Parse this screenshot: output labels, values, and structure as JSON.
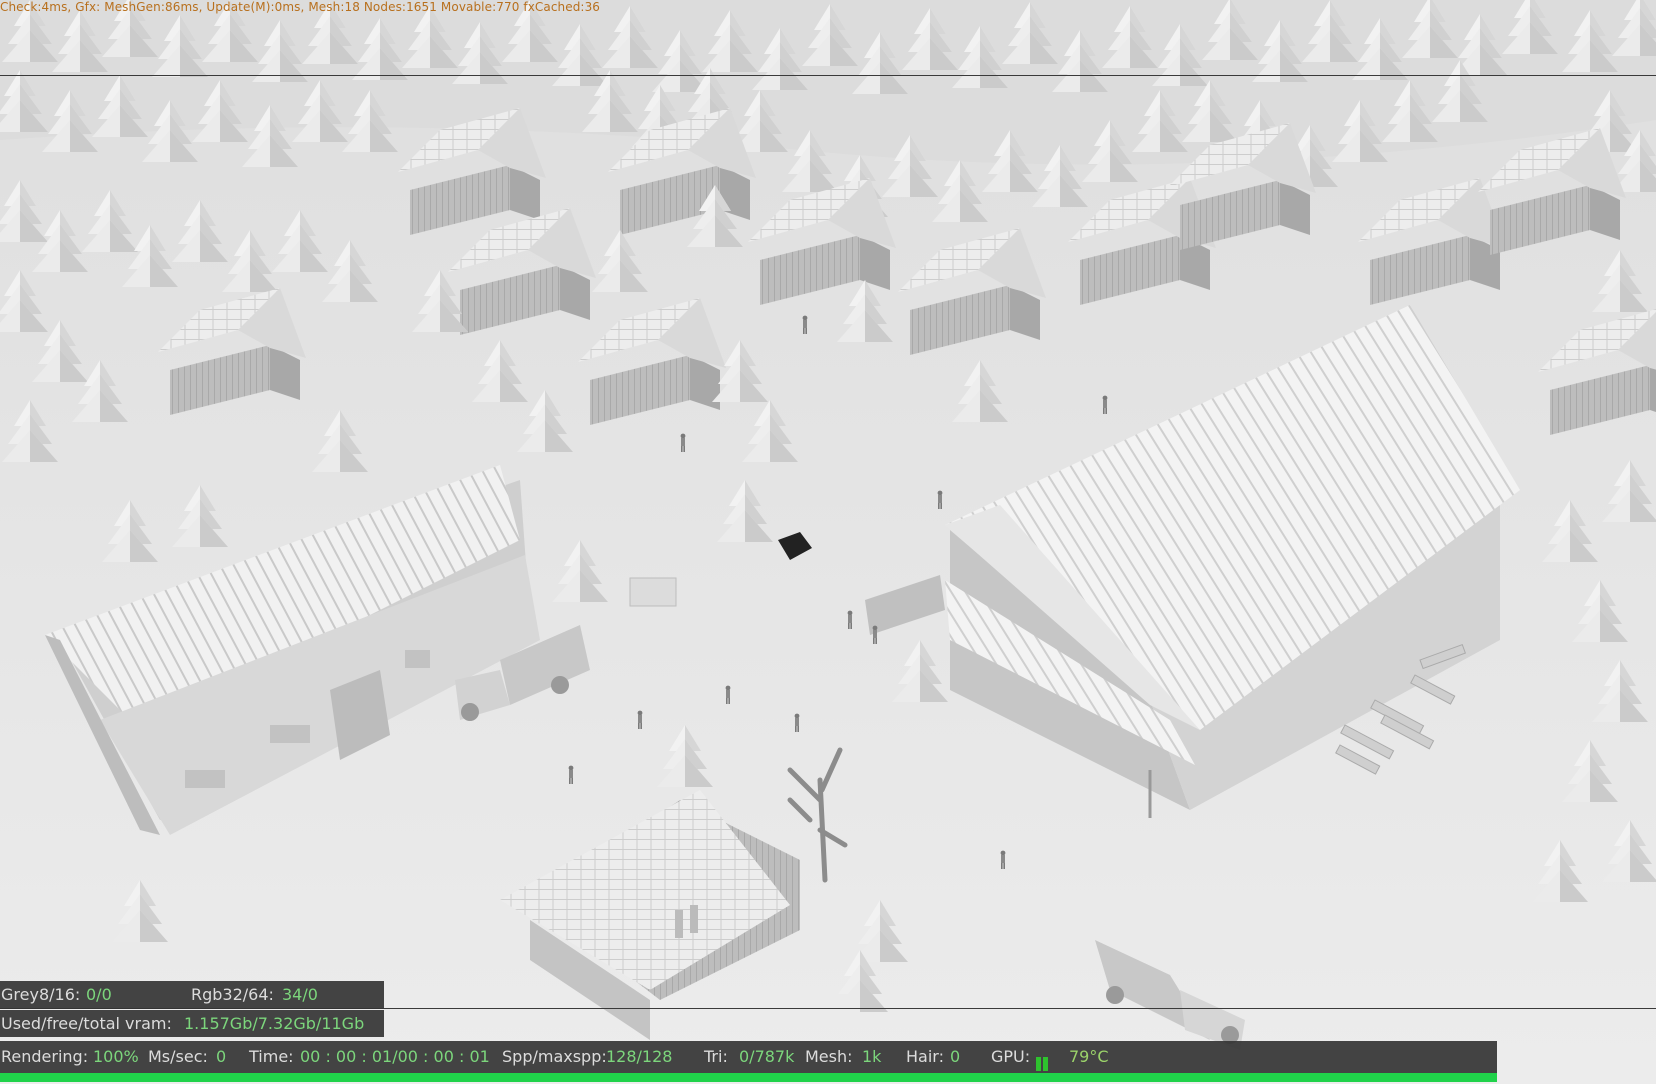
{
  "debug_line": "Check:4ms, Gfx: MeshGen:86ms, Update(M):0ms, Mesh:18 Nodes:1651 Movable:770 fxCached:36",
  "stats": {
    "grey_label": "Grey8/16:",
    "grey_value": "0/0",
    "rgb_label": "Rgb32/64:",
    "rgb_value": "34/0",
    "vram_label": "Used/free/total vram:",
    "vram_value": "1.157Gb/7.32Gb/11Gb"
  },
  "status_bar": {
    "rendering_label": "Rendering:",
    "rendering_value": "100%",
    "ms_label": "Ms/sec:",
    "ms_value": "0",
    "time_label": "Time:",
    "time_value": "00 : 00 : 01/00 : 00 : 01",
    "spp_label": "Spp/maxspp:",
    "spp_value": "128/128",
    "tri_label": "Tri:",
    "tri_value": "0/787k",
    "mesh_label": "Mesh:",
    "mesh_value": "1k",
    "hair_label": "Hair:",
    "hair_value": "0",
    "gpu_label": "GPU:",
    "gpu_temp": "79°C"
  },
  "render_progress": 1.0,
  "colors": {
    "value_green": "#7cd67c",
    "debug_orange": "#b8701e",
    "progress_green": "#20d24a",
    "panel_bg": "#343434"
  }
}
